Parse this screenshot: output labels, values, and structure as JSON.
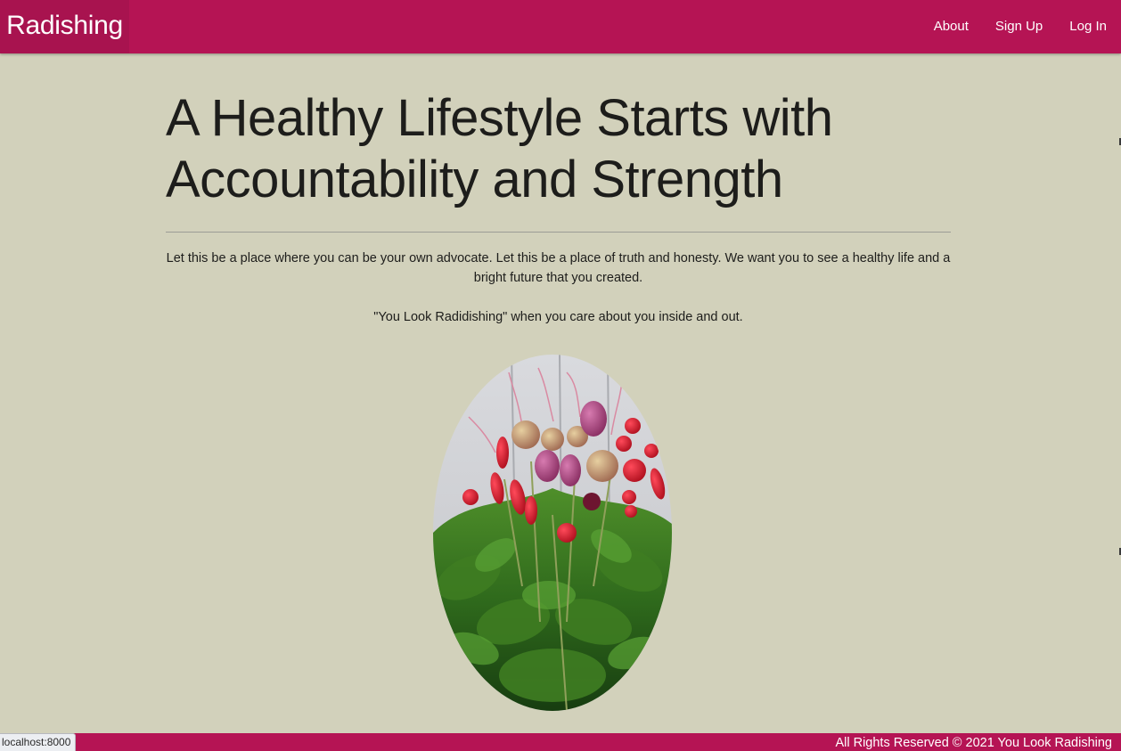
{
  "navbar": {
    "brand": "Radishing",
    "links": [
      "About",
      "Sign Up",
      "Log In"
    ],
    "background_color": "#b51454"
  },
  "main": {
    "headline": "A Healthy Lifestyle Starts with Accountability and Strength",
    "intro": "Let this be a place where you can be your own advocate. Let this be a place of truth and honesty. We want you to see a healthy life and a bright future that you created.",
    "quote": "\"You Look Radidishing\" when you care about you inside and out.",
    "image_subject": "radishes-photo",
    "background_color": "#d2d1bb"
  },
  "footer": {
    "text": "All Rights Reserved © 2021 You Look Radishing"
  },
  "status_bar": {
    "url": "localhost:8000"
  }
}
